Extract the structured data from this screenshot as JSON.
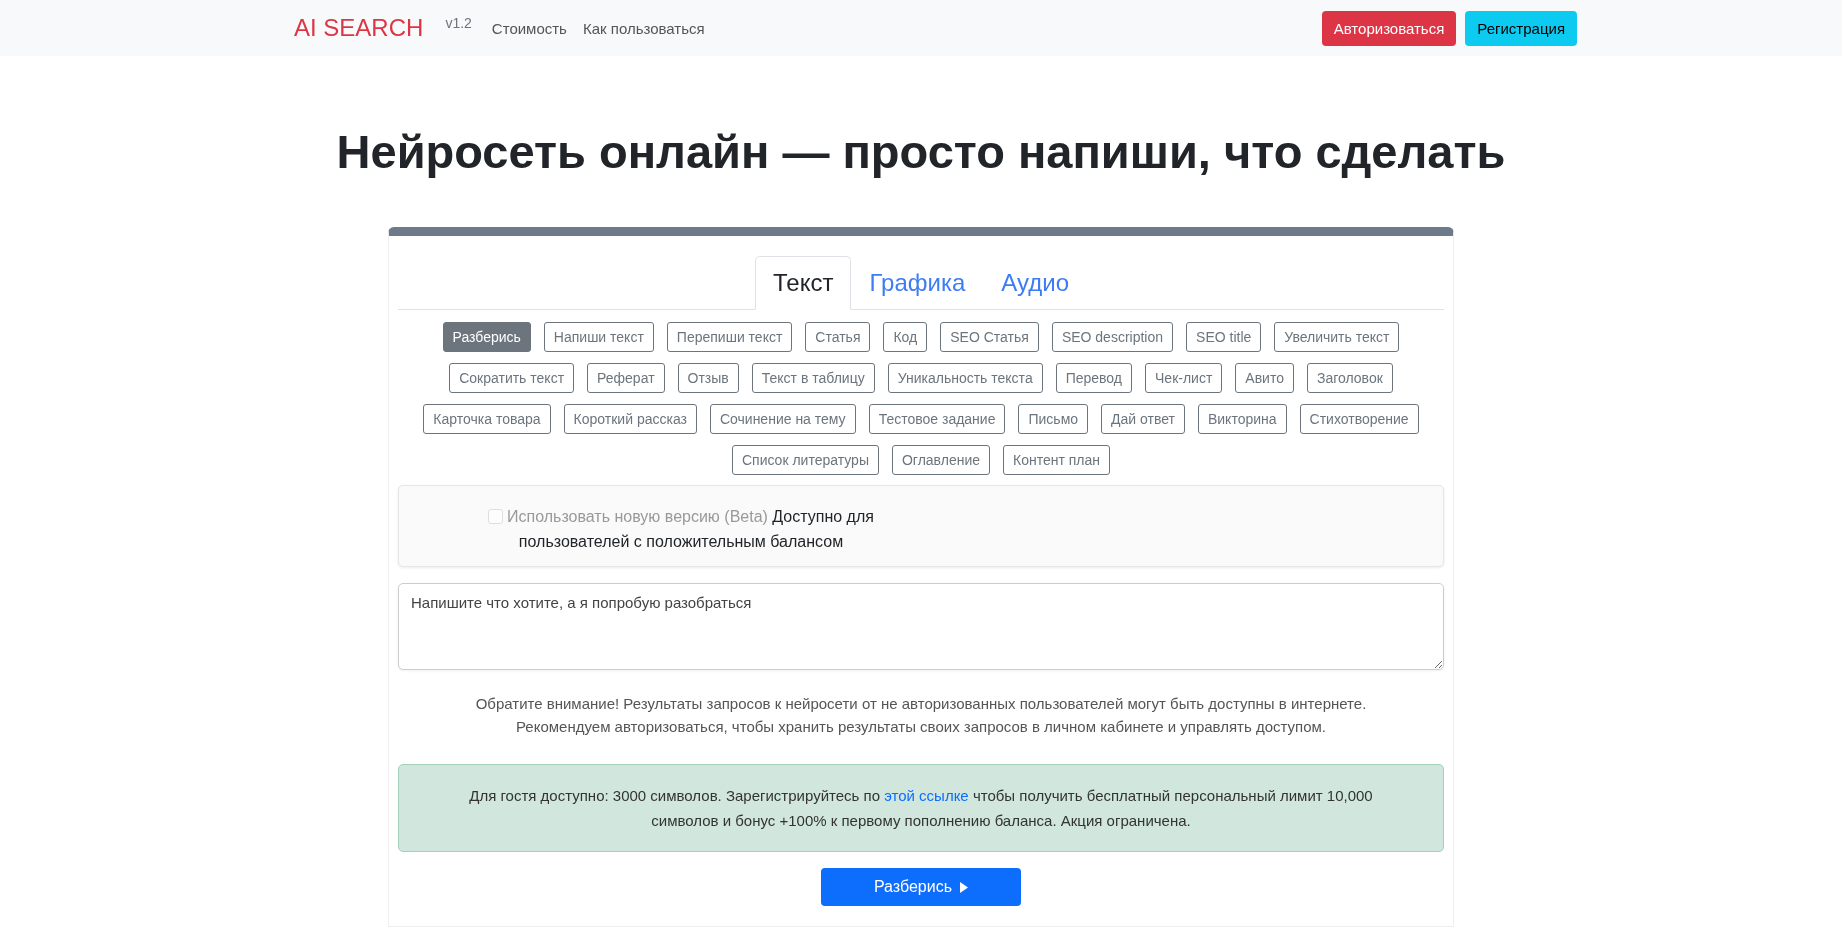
{
  "navbar": {
    "brand": "AI SEARCH",
    "version": "v1.2",
    "links": [
      "Стоимость",
      "Как пользоваться"
    ],
    "buttons": [
      {
        "label": "Авторизоваться",
        "kind": "danger"
      },
      {
        "label": "Регистрация",
        "kind": "info"
      }
    ]
  },
  "heading": "Нейросеть онлайн — просто напиши, что сделать",
  "tabs": [
    {
      "label": "Текст",
      "selected": true
    },
    {
      "label": "Графика",
      "selected": false
    },
    {
      "label": "Аудио",
      "selected": false
    }
  ],
  "modes": [
    {
      "label": "Разберись",
      "selected": true
    },
    {
      "label": "Напиши текст",
      "selected": false
    },
    {
      "label": "Перепиши текст",
      "selected": false
    },
    {
      "label": "Статья",
      "selected": false
    },
    {
      "label": "Код",
      "selected": false
    },
    {
      "label": "SEO Статья",
      "selected": false
    },
    {
      "label": "SEO description",
      "selected": false
    },
    {
      "label": "SEO title",
      "selected": false
    },
    {
      "label": "Увеличить текст",
      "selected": false
    },
    {
      "label": "Сократить текст",
      "selected": false
    },
    {
      "label": "Реферат",
      "selected": false
    },
    {
      "label": "Отзыв",
      "selected": false
    },
    {
      "label": "Текст в таблицу",
      "selected": false
    },
    {
      "label": "Уникальность текста",
      "selected": false
    },
    {
      "label": "Перевод",
      "selected": false
    },
    {
      "label": "Чек-лист",
      "selected": false
    },
    {
      "label": "Авито",
      "selected": false
    },
    {
      "label": "Заголовок",
      "selected": false
    },
    {
      "label": "Карточка товара",
      "selected": false
    },
    {
      "label": "Короткий рассказ",
      "selected": false
    },
    {
      "label": "Сочинение на тему",
      "selected": false
    },
    {
      "label": "Тестовое задание",
      "selected": false
    },
    {
      "label": "Письмо",
      "selected": false
    },
    {
      "label": "Дай ответ",
      "selected": false
    },
    {
      "label": "Викторина",
      "selected": false
    },
    {
      "label": "Стихотворение",
      "selected": false
    },
    {
      "label": "Список литературы",
      "selected": false
    },
    {
      "label": "Оглавление",
      "selected": false
    },
    {
      "label": "Контент план",
      "selected": false
    }
  ],
  "beta": {
    "label": "Использовать новую версию (Beta)",
    "note": "Доступно для пользователей с положительным балансом",
    "checked": false,
    "disabled": true
  },
  "prompt": {
    "placeholder": "Напишите что хотите, а я попробую разобраться"
  },
  "notice": [
    "Обратите внимание! Результаты запросов к нейросети от не авторизованных пользователей могут быть доступны в интернете.",
    "Рекомендуем авторизоваться, чтобы хранить результаты своих запросов в личном кабинете и управлять доступом."
  ],
  "alert": {
    "before": "Для гостя доступно: 3000 символов. Зарегистрируйтесь по",
    "link": "этой ссылке",
    "after": "чтобы получить бесплатный персональный лимит 10,000 символов и бонус +100% к первому пополнению баланса. Акция ограничена."
  },
  "submit": {
    "label": "Разберись"
  }
}
